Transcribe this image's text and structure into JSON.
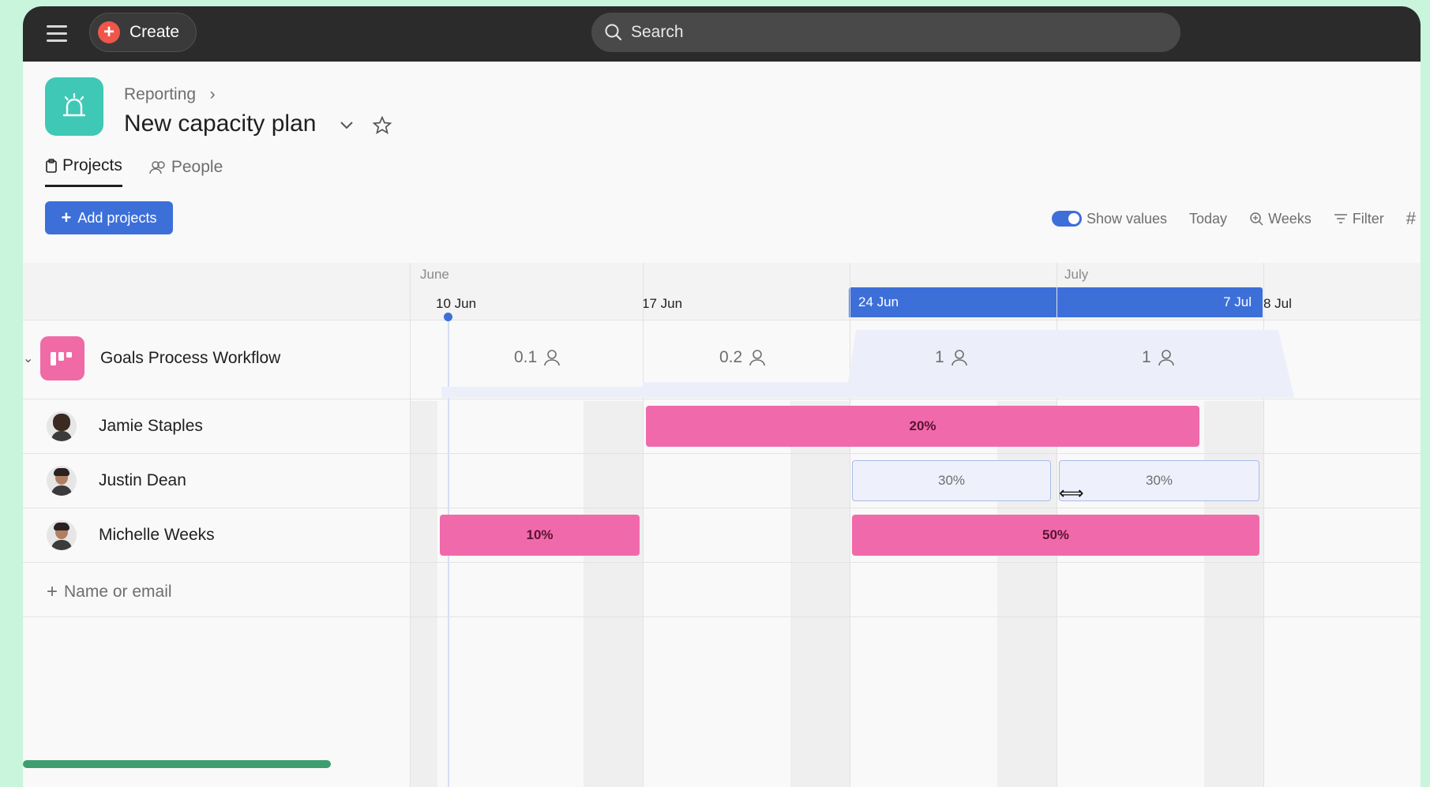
{
  "topbar": {
    "create_label": "Create",
    "search_placeholder": "Search"
  },
  "header": {
    "breadcrumb": "Reporting",
    "title": "New capacity plan",
    "tabs": [
      {
        "label": "Projects",
        "active": true
      },
      {
        "label": "People",
        "active": false
      }
    ]
  },
  "toolbar": {
    "add_projects": "Add projects",
    "show_values": "Show values",
    "show_values_on": true,
    "today": "Today",
    "weeks": "Weeks",
    "filter": "Filter",
    "more": "#"
  },
  "timeline": {
    "months": [
      "June",
      "July"
    ],
    "weeks": [
      "10 Jun",
      "17 Jun",
      "24 Jun",
      "7 Jul",
      "8 Jul"
    ],
    "highlight_color": "#3d6fd9"
  },
  "project": {
    "name": "Goals Process Workflow",
    "weekly_values": [
      "0.1",
      "0.2",
      "1",
      "1"
    ]
  },
  "people": [
    {
      "name": "Jamie Staples",
      "allocations": [
        "20%"
      ]
    },
    {
      "name": "Justin Dean",
      "allocations": [
        "30%",
        "30%"
      ]
    },
    {
      "name": "Michelle Weeks",
      "allocations": [
        "10%",
        "50%"
      ]
    }
  ],
  "add_person_placeholder": "Name or email",
  "colors": {
    "accent": "#3d6fd9",
    "allocation_pink": "#f06aab",
    "project_teal": "#3fc8b6",
    "project_pink": "#f06aa6"
  }
}
